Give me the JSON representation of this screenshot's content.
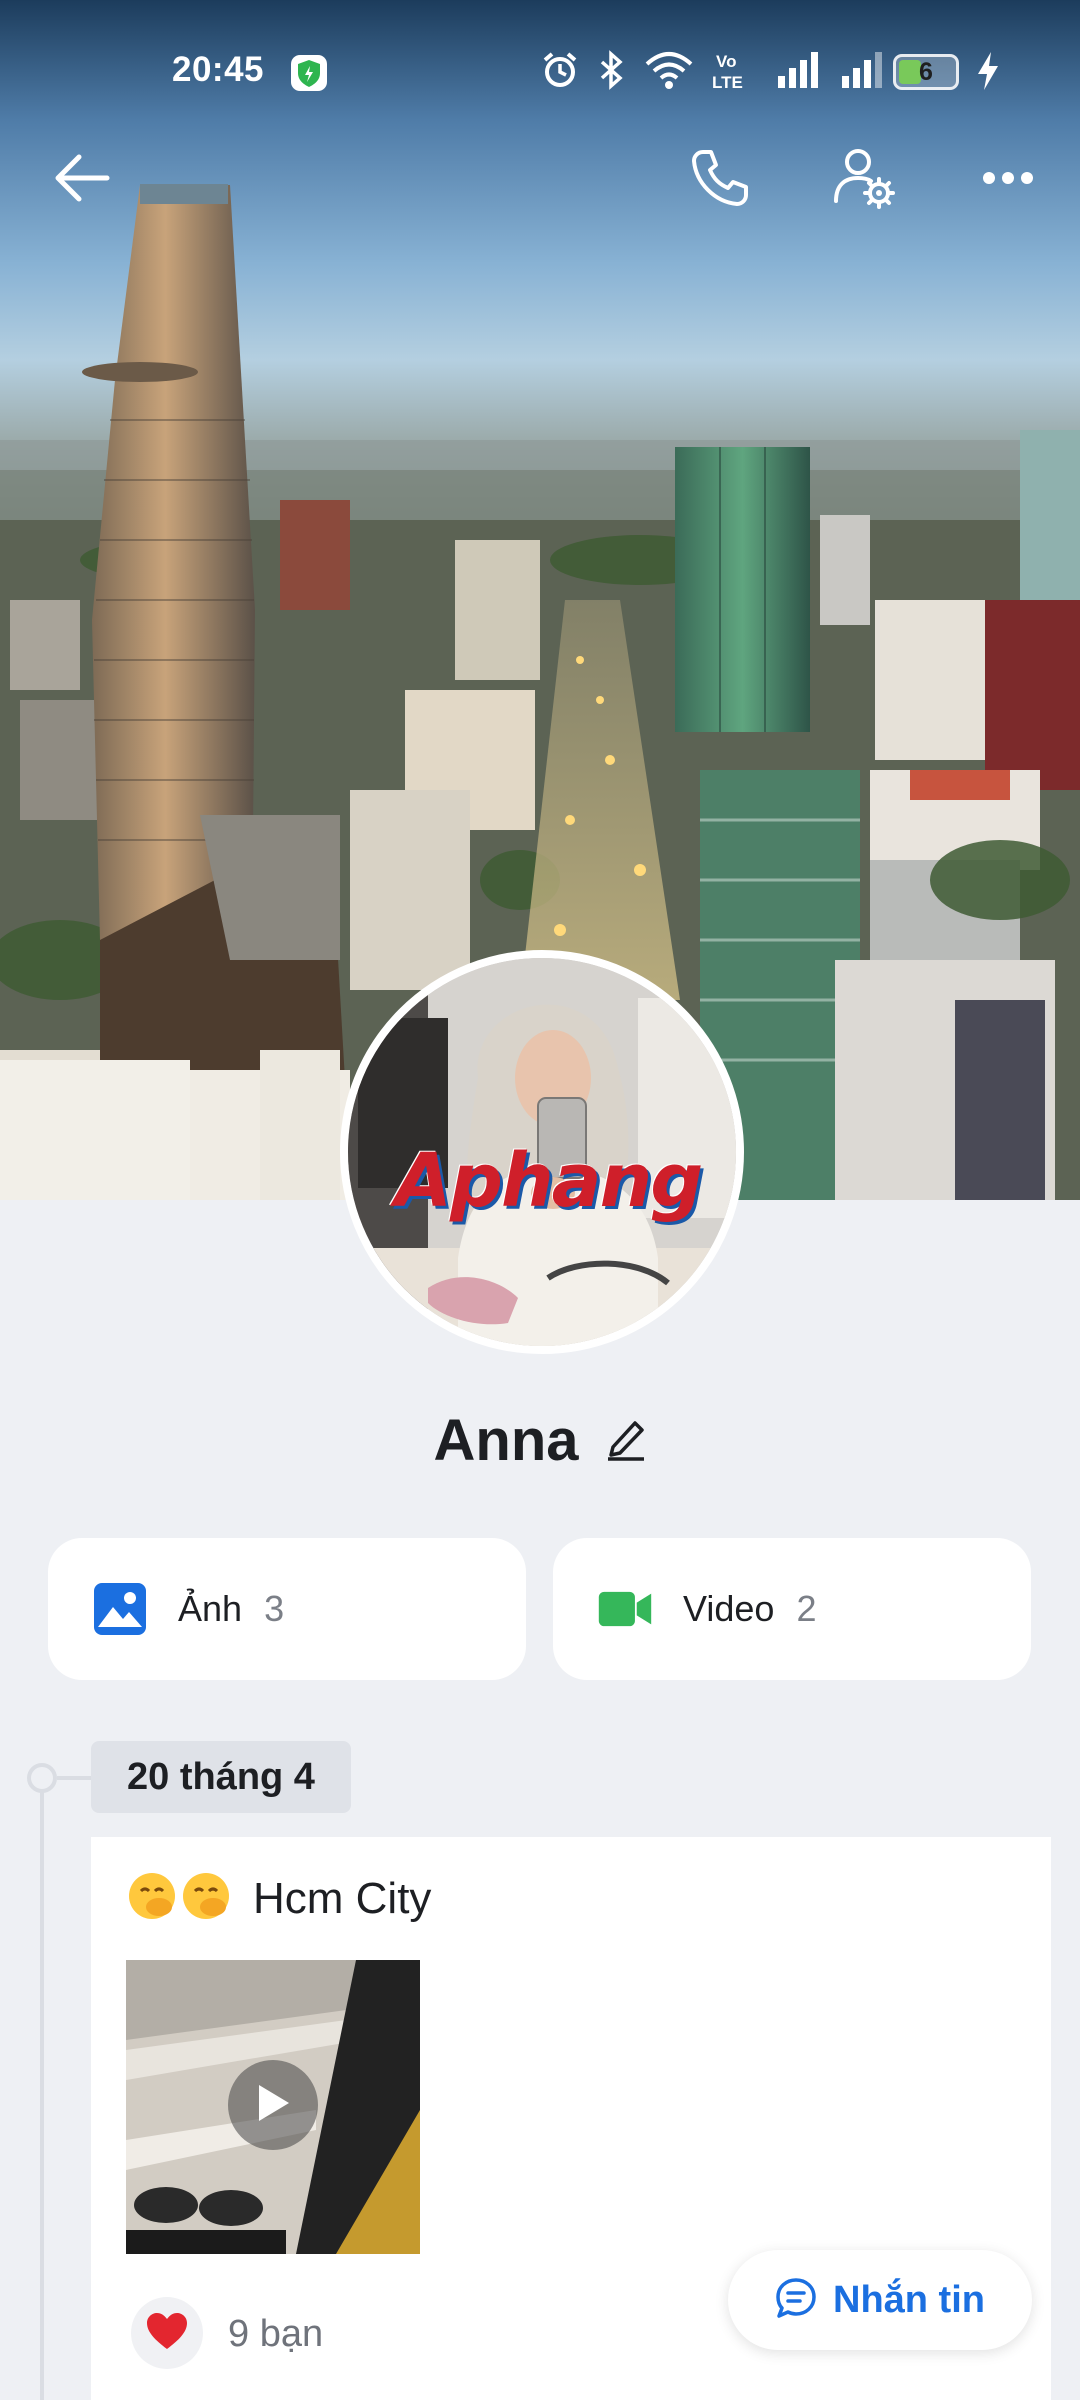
{
  "status_bar": {
    "time": "20:45",
    "battery_level": "6",
    "network_label": "Vo LTE"
  },
  "profile": {
    "name": "Anna",
    "avatar_watermark": "Aphang"
  },
  "media": {
    "photos": {
      "label": "Ảnh",
      "count": "3",
      "icon": "image-icon",
      "color": "#1b6fe0"
    },
    "videos": {
      "label": "Video",
      "count": "2",
      "icon": "video-camera-icon",
      "color": "#35b75a"
    }
  },
  "timeline": {
    "date": "20 tháng 4",
    "post": {
      "emojis": "🤭🤭",
      "caption": "Hcm City",
      "media_type": "video",
      "reaction_icon": "heart-icon",
      "reaction_count": "9 bạn"
    }
  },
  "actions": {
    "message_label": "Nhắn tin"
  },
  "colors": {
    "accent": "#1b6fe0",
    "page_background": "#eef0f4",
    "heart": "#e3262f"
  }
}
